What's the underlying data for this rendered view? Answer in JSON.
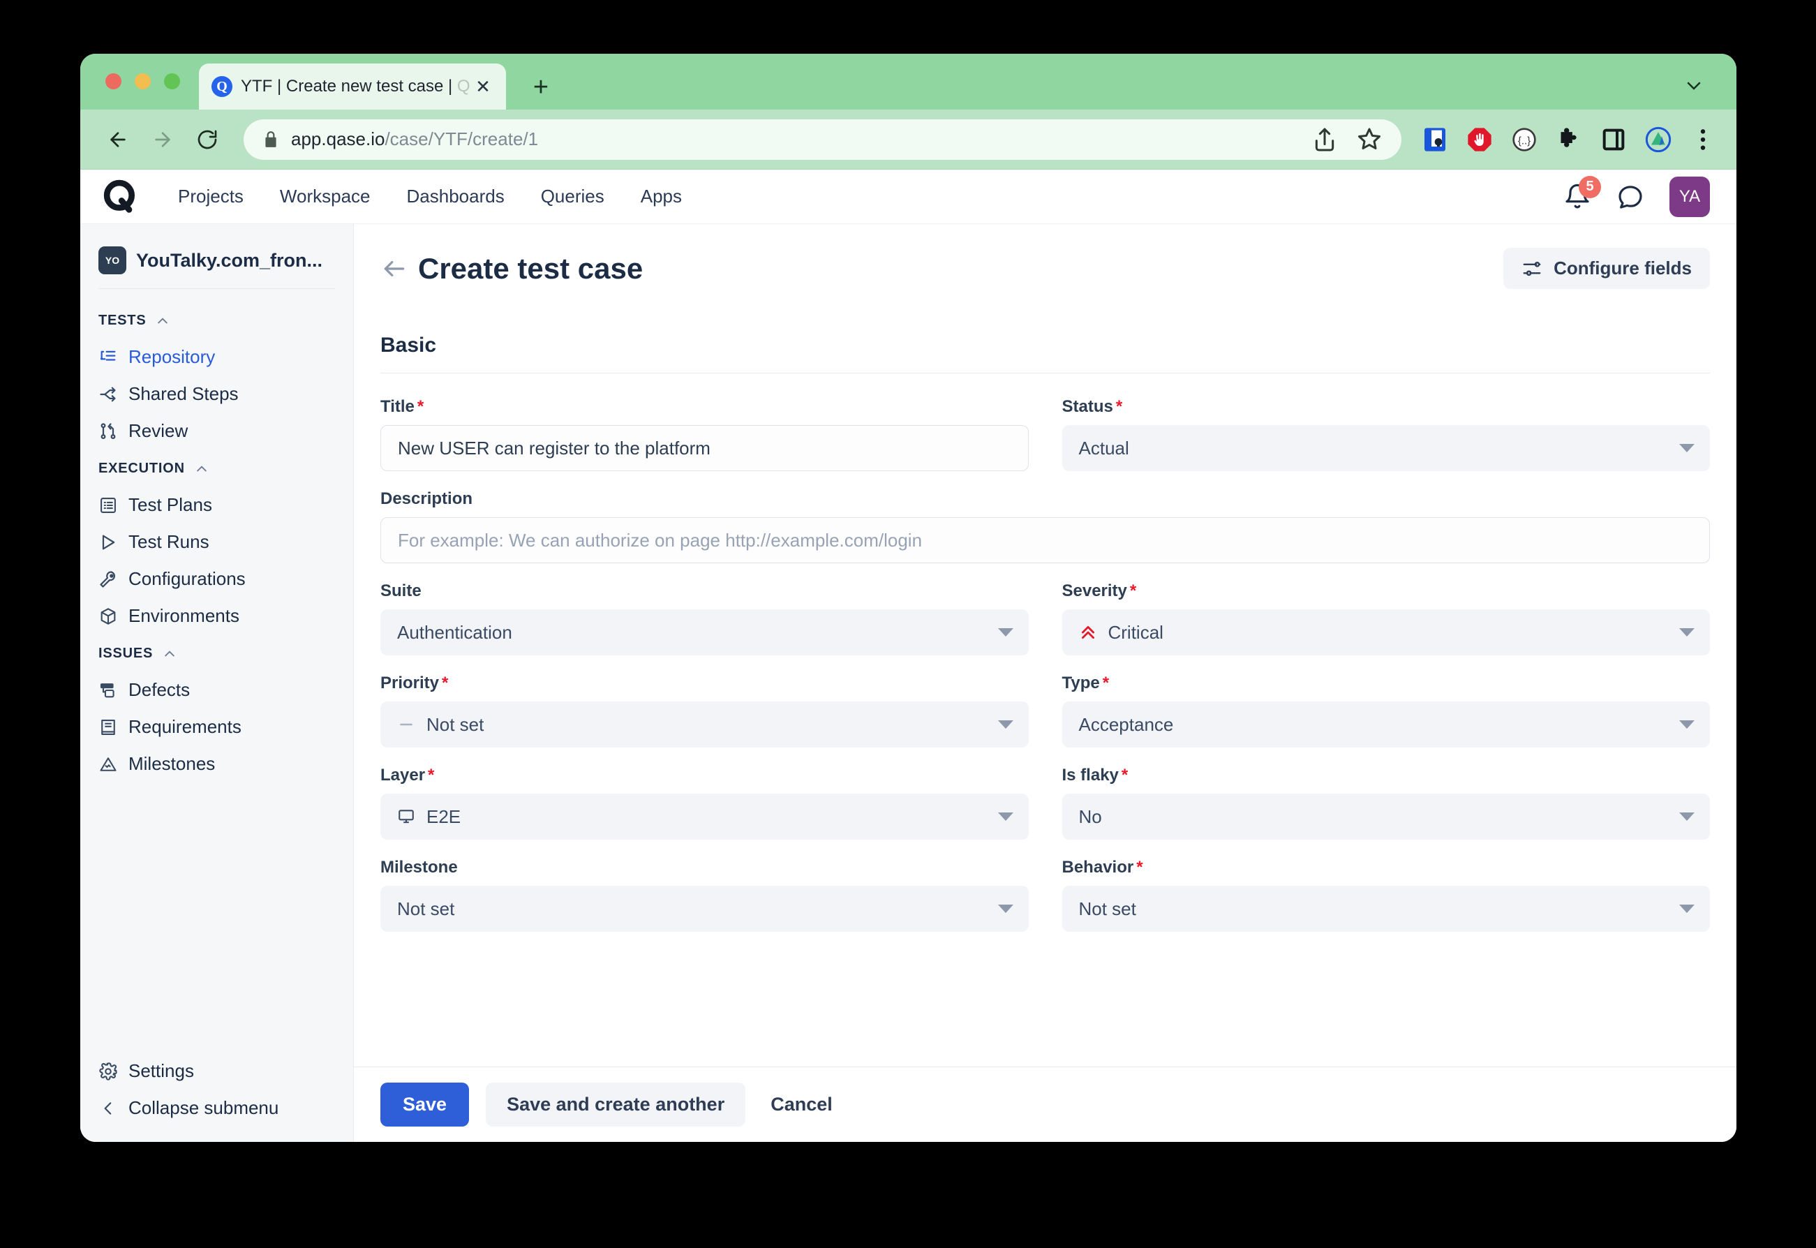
{
  "browser": {
    "tab": {
      "title": "YTF | Create new test case | ",
      "title_dim": "Q",
      "favicon": "Q",
      "close_icon": "close-icon"
    },
    "new_tab_label": "+",
    "url_host": "app.qase.io",
    "url_path": "/case/YTF/create/1",
    "extensions": [
      "share-icon",
      "bookmark-star-icon",
      "password-manager-icon",
      "adblock-icon",
      "privacy-icon",
      "puzzle-extensions-icon",
      "side-panel-icon",
      "sync-profile-icon",
      "browser-menu-icon"
    ]
  },
  "app_header": {
    "logo": "qase-logo",
    "nav": [
      {
        "label": "Projects"
      },
      {
        "label": "Workspace"
      },
      {
        "label": "Dashboards"
      },
      {
        "label": "Queries"
      },
      {
        "label": "Apps"
      }
    ],
    "notification_count": "5",
    "avatar_initials": "YA"
  },
  "sidebar": {
    "project_badge": "YO",
    "project_name": "YouTalky.com_fron...",
    "groups": [
      {
        "title": "TESTS",
        "items": [
          {
            "label": "Repository",
            "icon": "repository-icon",
            "active": true
          },
          {
            "label": "Shared Steps",
            "icon": "shared-steps-icon",
            "active": false
          },
          {
            "label": "Review",
            "icon": "review-branch-icon",
            "active": false
          }
        ]
      },
      {
        "title": "EXECUTION",
        "items": [
          {
            "label": "Test Plans",
            "icon": "test-plans-icon",
            "active": false
          },
          {
            "label": "Test Runs",
            "icon": "test-runs-play-icon",
            "active": false
          },
          {
            "label": "Configurations",
            "icon": "wrench-icon",
            "active": false
          },
          {
            "label": "Environments",
            "icon": "cube-icon",
            "active": false
          }
        ]
      },
      {
        "title": "ISSUES",
        "items": [
          {
            "label": "Defects",
            "icon": "defects-icon",
            "active": false
          },
          {
            "label": "Requirements",
            "icon": "requirements-book-icon",
            "active": false
          },
          {
            "label": "Milestones",
            "icon": "milestones-mountain-icon",
            "active": false
          }
        ]
      }
    ],
    "bottom": [
      {
        "label": "Settings",
        "icon": "gear-icon"
      },
      {
        "label": "Collapse submenu",
        "icon": "chevron-left-icon"
      }
    ]
  },
  "page": {
    "title": "Create test case",
    "back_icon": "back-arrow-icon",
    "configure_fields_label": "Configure fields",
    "configure_fields_icon": "sliders-icon",
    "section_basic": "Basic"
  },
  "form": {
    "title": {
      "label": "Title",
      "required": true,
      "value": "New USER can register to the platform"
    },
    "status": {
      "label": "Status",
      "required": true,
      "value": "Actual"
    },
    "description": {
      "label": "Description",
      "required": false,
      "value": "",
      "placeholder": "For example: We can authorize on page http://example.com/login"
    },
    "suite": {
      "label": "Suite",
      "required": false,
      "value": "Authentication"
    },
    "severity": {
      "label": "Severity",
      "required": true,
      "value": "Critical",
      "icon": "severity-critical-chevrons-icon"
    },
    "priority": {
      "label": "Priority",
      "required": true,
      "value": "Not set",
      "icon": "priority-dash-icon"
    },
    "type": {
      "label": "Type",
      "required": true,
      "value": "Acceptance"
    },
    "layer": {
      "label": "Layer",
      "required": true,
      "value": "E2E",
      "icon": "monitor-icon"
    },
    "is_flaky": {
      "label": "Is flaky",
      "required": true,
      "value": "No"
    },
    "milestone": {
      "label": "Milestone",
      "required": false,
      "value": "Not set"
    },
    "behavior": {
      "label": "Behavior",
      "required": true,
      "value": "Not set"
    }
  },
  "footer": {
    "save_label": "Save",
    "save_another_label": "Save and create another",
    "cancel_label": "Cancel"
  },
  "colors": {
    "primary": "#2e5fd8",
    "required": "#e8192c",
    "accent_link": "#2a5bd7",
    "avatar": "#7d3a87",
    "badge": "#ef6d63",
    "browser_chrome": "#8fd6a0"
  }
}
